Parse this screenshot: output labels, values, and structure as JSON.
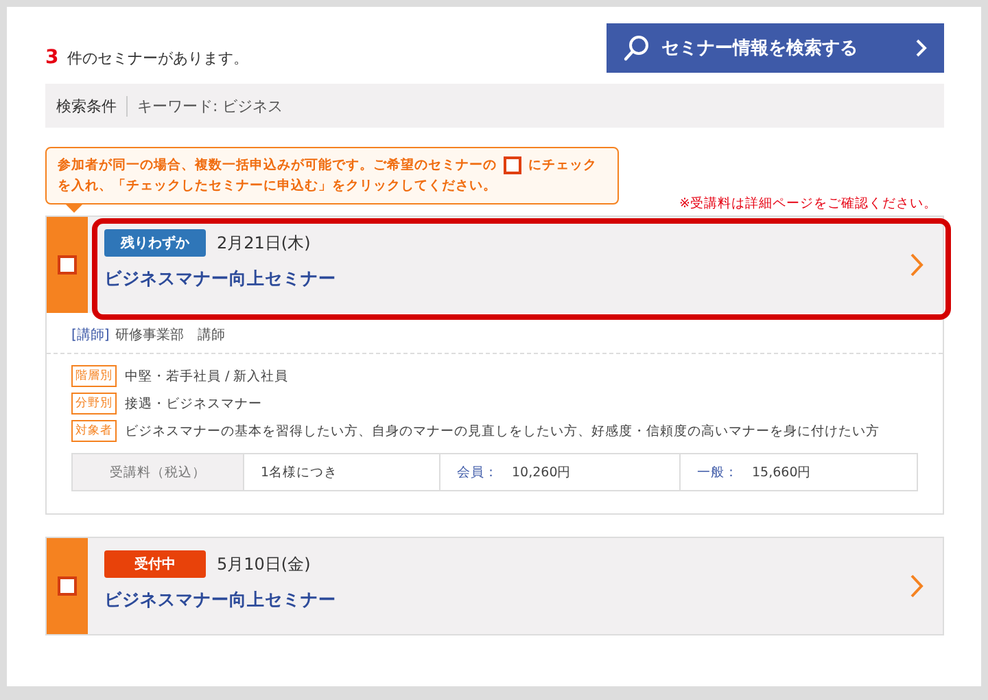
{
  "result": {
    "count": "3",
    "label": "件のセミナーがあります。"
  },
  "search_button": {
    "label": "セミナー情報を検索する"
  },
  "criteria": {
    "label": "検索条件",
    "value": "キーワード: ビジネス"
  },
  "notice": {
    "before": "参加者が同一の場合、複数一括申込みが可能です。ご希望のセミナーの",
    "after": "にチェック",
    "second_line": "を入れ、「チェックしたセミナーに申込む」をクリックしてください。"
  },
  "fee_note": "※受講料は詳細ページをご確認ください。",
  "seminars": [
    {
      "status": "残りわずか",
      "color": "#2f76b8",
      "date": "2月21日(木)",
      "title": "ビジネスマナー向上セミナー",
      "checked": false,
      "highlighted": true,
      "instructor": {
        "label": "[講師]",
        "value": "研修事業部　講師"
      },
      "tags": [
        {
          "label": "階層別",
          "value": "中堅・若手社員 / 新入社員"
        },
        {
          "label": "分野別",
          "value": "接遇・ビジネスマナー"
        },
        {
          "label": "対象者",
          "value": "ビジネスマナーの基本を習得したい方、自身のマナーの見直しをしたい方、好感度・信頼度の高いマナーを身に付けたい方"
        }
      ],
      "fee": {
        "label": "受講料（税込）",
        "unit": "1名様につき",
        "member_label": "会員：",
        "member_price": "10,260円",
        "general_label": "一般：",
        "general_price": "15,660円"
      }
    },
    {
      "status": "受付中",
      "color": "#e8420a",
      "date": "5月10日(金)",
      "title": "ビジネスマナー向上セミナー",
      "checked": false,
      "highlighted": false
    }
  ]
}
